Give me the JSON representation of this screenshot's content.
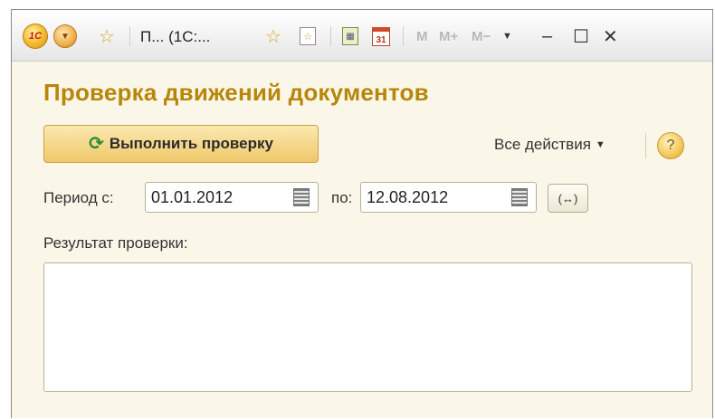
{
  "titlebar": {
    "title": "П... (1С:...",
    "logo_text": "1С",
    "memory_buttons": [
      "M",
      "M+",
      "M−"
    ],
    "calendar_day": "31"
  },
  "page": {
    "title": "Проверка движений документов",
    "run_button_label": "Выполнить проверку",
    "all_actions_label": "Все действия",
    "help_label": "?"
  },
  "period": {
    "from_label": "Период с:",
    "from_value": "01.01.2012",
    "to_label": "по:",
    "to_value": "12.08.2012",
    "range_button_label": "(↔)"
  },
  "result": {
    "label": "Результат проверки:",
    "value": ""
  },
  "colors": {
    "title": "#b8860b",
    "background": "#fbf7e8",
    "button_fill": "#f0c86a"
  }
}
